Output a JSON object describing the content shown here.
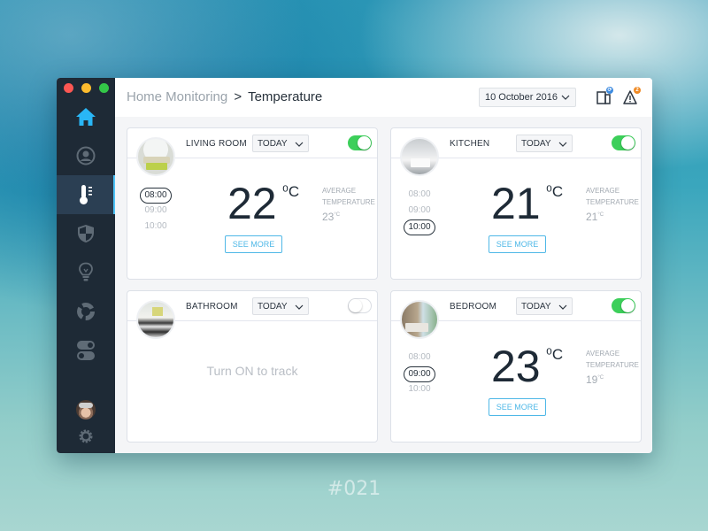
{
  "window": {
    "traffic_lights": [
      "close",
      "minimize",
      "maximize"
    ]
  },
  "sidebar": {
    "items": [
      {
        "icon": "home-icon",
        "active": false,
        "color": "#29b6f6"
      },
      {
        "icon": "user-circle-icon",
        "active": false
      },
      {
        "icon": "thermometer-icon",
        "active": true
      },
      {
        "icon": "shield-icon",
        "active": false
      },
      {
        "icon": "lightbulb-icon",
        "active": false
      },
      {
        "icon": "ring-chart-icon",
        "active": false
      },
      {
        "icon": "switches-icon",
        "active": false
      }
    ],
    "bottom": [
      {
        "icon": "user-avatar"
      },
      {
        "icon": "gear-icon"
      }
    ]
  },
  "header": {
    "breadcrumb": {
      "parent": "Home Monitoring",
      "separator": ">",
      "current": "Temperature"
    },
    "date_select": {
      "value": "10 October 2016"
    },
    "devices_icon": {
      "icon": "devices-icon",
      "badge": "sync",
      "badge_color": "#3d8be0"
    },
    "alerts_icon": {
      "icon": "warning-icon",
      "badge": "2",
      "badge_color": "#f08a24"
    }
  },
  "rooms": [
    {
      "name": "LIVING ROOM",
      "period": "TODAY",
      "enabled": true,
      "times": [
        "08:00",
        "09:00",
        "10:00"
      ],
      "selected_time": "08:00",
      "temperature": "22",
      "unit": "⁰C",
      "avg_label_1": "AVERAGE",
      "avg_label_2": "TEMPERATURE",
      "avg_value": "23",
      "avg_unit": "°C",
      "see_more": "SEE MORE"
    },
    {
      "name": "KITCHEN",
      "period": "TODAY",
      "enabled": true,
      "times": [
        "08:00",
        "09:00",
        "10:00"
      ],
      "selected_time": "10:00",
      "temperature": "21",
      "unit": "⁰C",
      "avg_label_1": "AVERAGE",
      "avg_label_2": "TEMPERATURE",
      "avg_value": "21",
      "avg_unit": "°C",
      "see_more": "SEE MORE"
    },
    {
      "name": "BATHROOM",
      "period": "TODAY",
      "enabled": false,
      "placeholder": "Turn ON to track"
    },
    {
      "name": "BEDROOM",
      "period": "TODAY",
      "enabled": true,
      "times": [
        "08:00",
        "09:00",
        "10:00"
      ],
      "selected_time": "09:00",
      "temperature": "23",
      "unit": "⁰C",
      "avg_label_1": "AVERAGE",
      "avg_label_2": "TEMPERATURE",
      "avg_value": "19",
      "avg_unit": "°C",
      "see_more": "SEE MORE"
    }
  ],
  "colors": {
    "sidebar_bg": "#1e2a36",
    "accent": "#4fb8e7",
    "toggle_on": "#3ccf5a"
  },
  "footer_tag": "#021"
}
